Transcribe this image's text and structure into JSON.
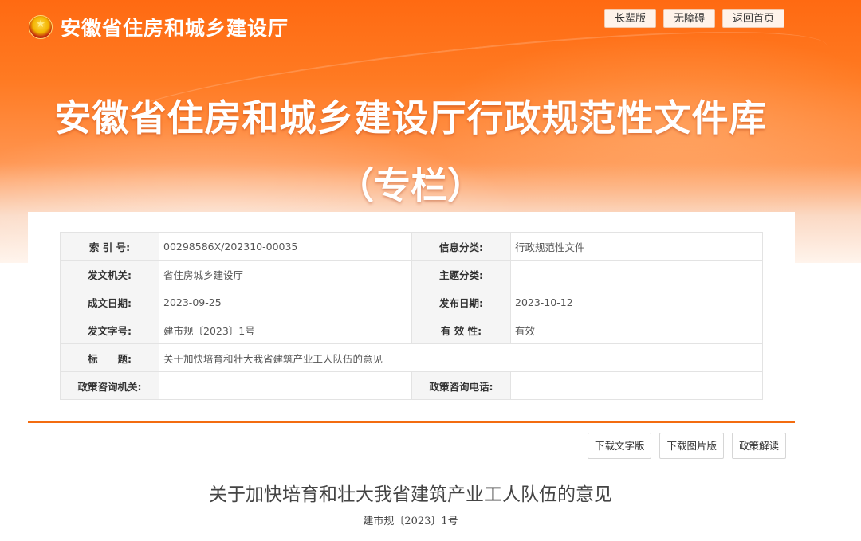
{
  "site": {
    "name": "安徽省住房和城乡建设厅",
    "emblem": "national-emblem-icon"
  },
  "top_links": [
    "长辈版",
    "无障碍",
    "返回首页"
  ],
  "hero": {
    "title": "安徽省住房和城乡建设厅行政规范性文件库",
    "subtitle": "（专栏）"
  },
  "meta": {
    "index_label": "索 引 号:",
    "index_value": "00298586X/202310-00035",
    "category_label": "信息分类:",
    "category_value": "行政规范性文件",
    "issuer_label": "发文机关:",
    "issuer_value": "省住房城乡建设厅",
    "topic_label": "主题分类:",
    "topic_value": "",
    "written_label": "成文日期:",
    "written_value": "2023-09-25",
    "published_label": "发布日期:",
    "published_value": "2023-10-12",
    "docno_label": "发文字号:",
    "docno_value": "建市规〔2023〕1号",
    "validity_label": "有 效 性:",
    "validity_value": "有效",
    "title_label": "标　　题:",
    "title_value": "关于加快培育和壮大我省建筑产业工人队伍的意见",
    "consult_org_label": "政策咨询机关:",
    "consult_org_value": "",
    "consult_phone_label": "政策咨询电话:",
    "consult_phone_value": ""
  },
  "actions": [
    "下载文字版",
    "下载图片版",
    "政策解读"
  ],
  "document": {
    "title": "关于加快培育和壮大我省建筑产业工人队伍的意见",
    "number": "建市规〔2023〕1号"
  },
  "colors": {
    "brand": "#ff6a12",
    "divider": "#f36c10"
  }
}
